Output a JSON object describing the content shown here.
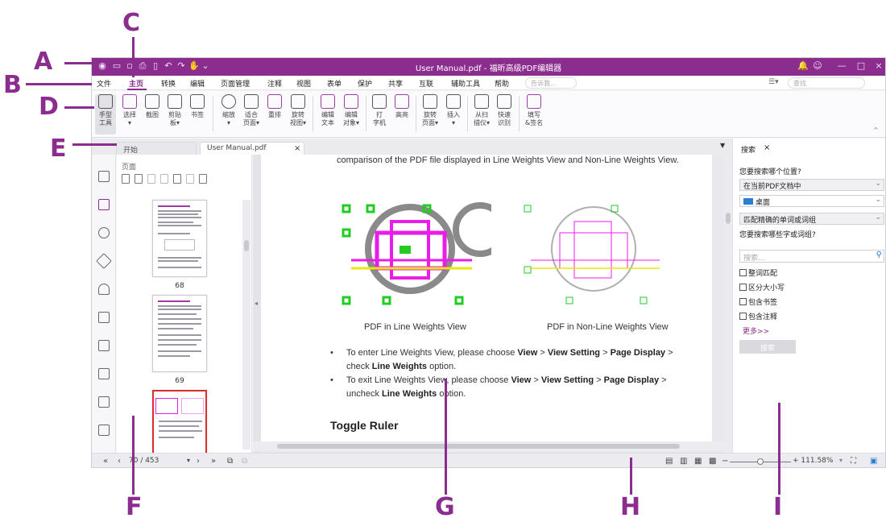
{
  "annotations": {
    "A": "A",
    "B": "B",
    "C": "C",
    "D": "D",
    "E": "E",
    "F": "F",
    "G": "G",
    "H": "H",
    "I": "I"
  },
  "titlebar": {
    "title": "User Manual.pdf - 福昕高级PDF编辑器"
  },
  "menu": {
    "items": [
      "文件",
      "主页",
      "转换",
      "编辑",
      "页面管理",
      "注释",
      "视图",
      "表单",
      "保护",
      "共享",
      "互联",
      "辅助工具",
      "帮助"
    ],
    "tell_me_placeholder": "告诉我...",
    "find_placeholder": "查找"
  },
  "ribbon": {
    "items": [
      "手型\n工具",
      "选择\n▾",
      "截图",
      "剪贴\n板▾",
      "书签",
      "缩放\n▾",
      "适合\n页面▾",
      "重排",
      "旋转\n视图▾",
      "编辑\n文本",
      "编辑\n对象▾",
      "打\n字机",
      "高亮",
      "旋转\n页面▾",
      "插入\n▾",
      "从扫\n描仪▾",
      "快速\n识别",
      "填写\n&签名"
    ]
  },
  "tabs": {
    "start": "开始",
    "doc": "User Manual.pdf",
    "close": "×"
  },
  "thumbnails": {
    "panel_title": "页面",
    "pages": [
      "68",
      "69"
    ]
  },
  "document": {
    "line1": "comparison of the PDF file displayed in Line Weights View and Non-Line Weights View.",
    "caption_left": "PDF in Line Weights View",
    "caption_right": "PDF in Non-Line Weights View",
    "b1_a": "To enter Line Weights View, please choose ",
    "b1_view": "View",
    "b1_sep1": " > ",
    "b1_setting": "View Setting",
    "b1_sep2": " > ",
    "b1_display": "Page Display",
    "b1_end": " >",
    "b1_l2a": "check ",
    "b1_lw": "Line Weights",
    "b1_l2b": " option.",
    "b2_a": "To exit Line Weights View, please choose ",
    "b2_view": "View",
    "b2_sep1": " > ",
    "b2_setting": "View Setting",
    "b2_sep2": " > ",
    "b2_display": "Page Display",
    "b2_end": " >",
    "b2_l2a": "uncheck ",
    "b2_lw": "Line Weights",
    "b2_l2b": " option.",
    "heading": "Toggle Ruler"
  },
  "search_pane": {
    "tab": "搜索",
    "close": "×",
    "q1": "您要搜索哪个位置?",
    "where": "在当前PDF文档中",
    "folder": "桌面",
    "match": "匹配精确的单词或词组",
    "q2": "您要搜索哪些字或词组?",
    "placeholder": "搜索...",
    "opt1": "整词匹配",
    "opt2": "区分大小写",
    "opt3": "包含书签",
    "opt4": "包含注释",
    "more": "更多>>",
    "button": "搜索"
  },
  "status": {
    "page_field": "70 / 453",
    "zoom": "+ 111.58%"
  },
  "colors": {
    "accent": "#8b2c8f",
    "green": "#22cc22",
    "magenta": "#e81ee8"
  }
}
